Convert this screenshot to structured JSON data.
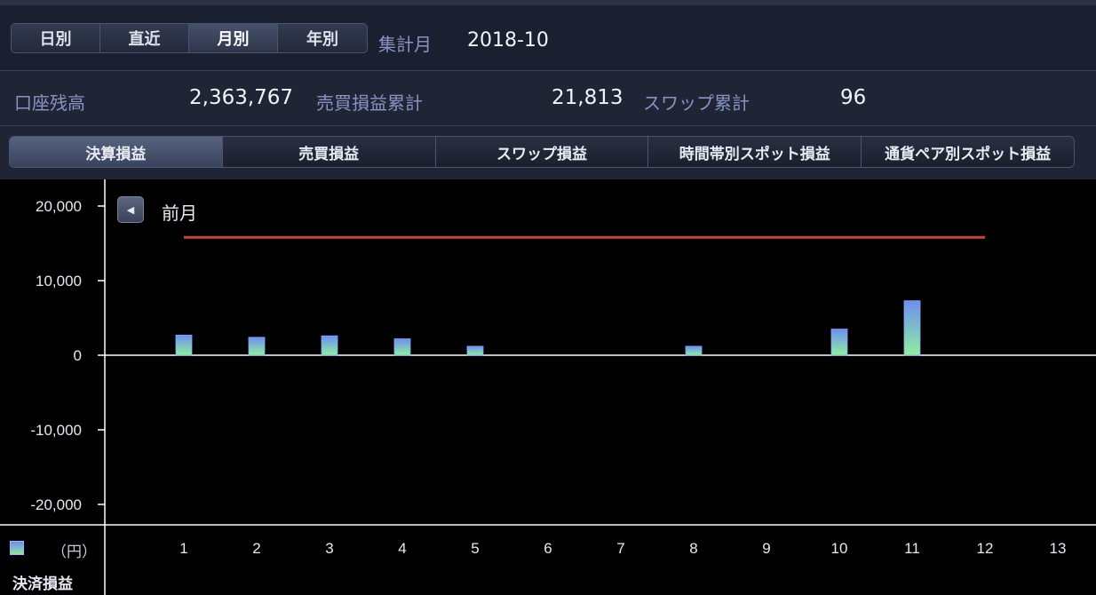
{
  "toolbar": {
    "period_buttons": [
      "日別",
      "直近",
      "月別",
      "年別"
    ],
    "active_period": 2,
    "period_label": "集計月",
    "period_value": "2018-10"
  },
  "summary": {
    "balance_label": "口座残高",
    "balance_value": "2,363,767",
    "trade_pl_label": "売買損益累計",
    "trade_pl_value": "21,813",
    "swap_label": "スワップ累計",
    "swap_value": "96"
  },
  "tabs": {
    "items": [
      "決算損益",
      "売買損益",
      "スワップ損益",
      "時間帯別スポット損益",
      "通貨ペア別スポット損益"
    ],
    "active": 0
  },
  "nav": {
    "prev_label": "前月",
    "prev_icon": "triangle-left-icon"
  },
  "legend": {
    "unit": "（円）",
    "series_name": "決済損益"
  },
  "colors": {
    "bar_top": "#6f8ef0",
    "bar_bottom": "#8ff0a0",
    "line": "#c0453c",
    "axis": "#ffffff"
  },
  "chart_data": {
    "type": "bar",
    "categories": [
      "1",
      "2",
      "3",
      "4",
      "5",
      "6",
      "7",
      "8",
      "9",
      "10",
      "11",
      "12",
      "13"
    ],
    "ylim": [
      -23000,
      23000
    ],
    "y_ticks": [
      20000,
      10000,
      0,
      -10000,
      -20000
    ],
    "y_tick_labels": [
      "20,000",
      "10,000",
      "0",
      "-10,000",
      "-20,000"
    ],
    "series": [
      {
        "name": "決済損益",
        "values": [
          2700,
          2400,
          2600,
          2200,
          1200,
          0,
          0,
          1200,
          0,
          3500,
          7300,
          0,
          0
        ]
      }
    ],
    "reference_line": {
      "value": 15800,
      "from_category": "1",
      "to_category": "12"
    }
  }
}
